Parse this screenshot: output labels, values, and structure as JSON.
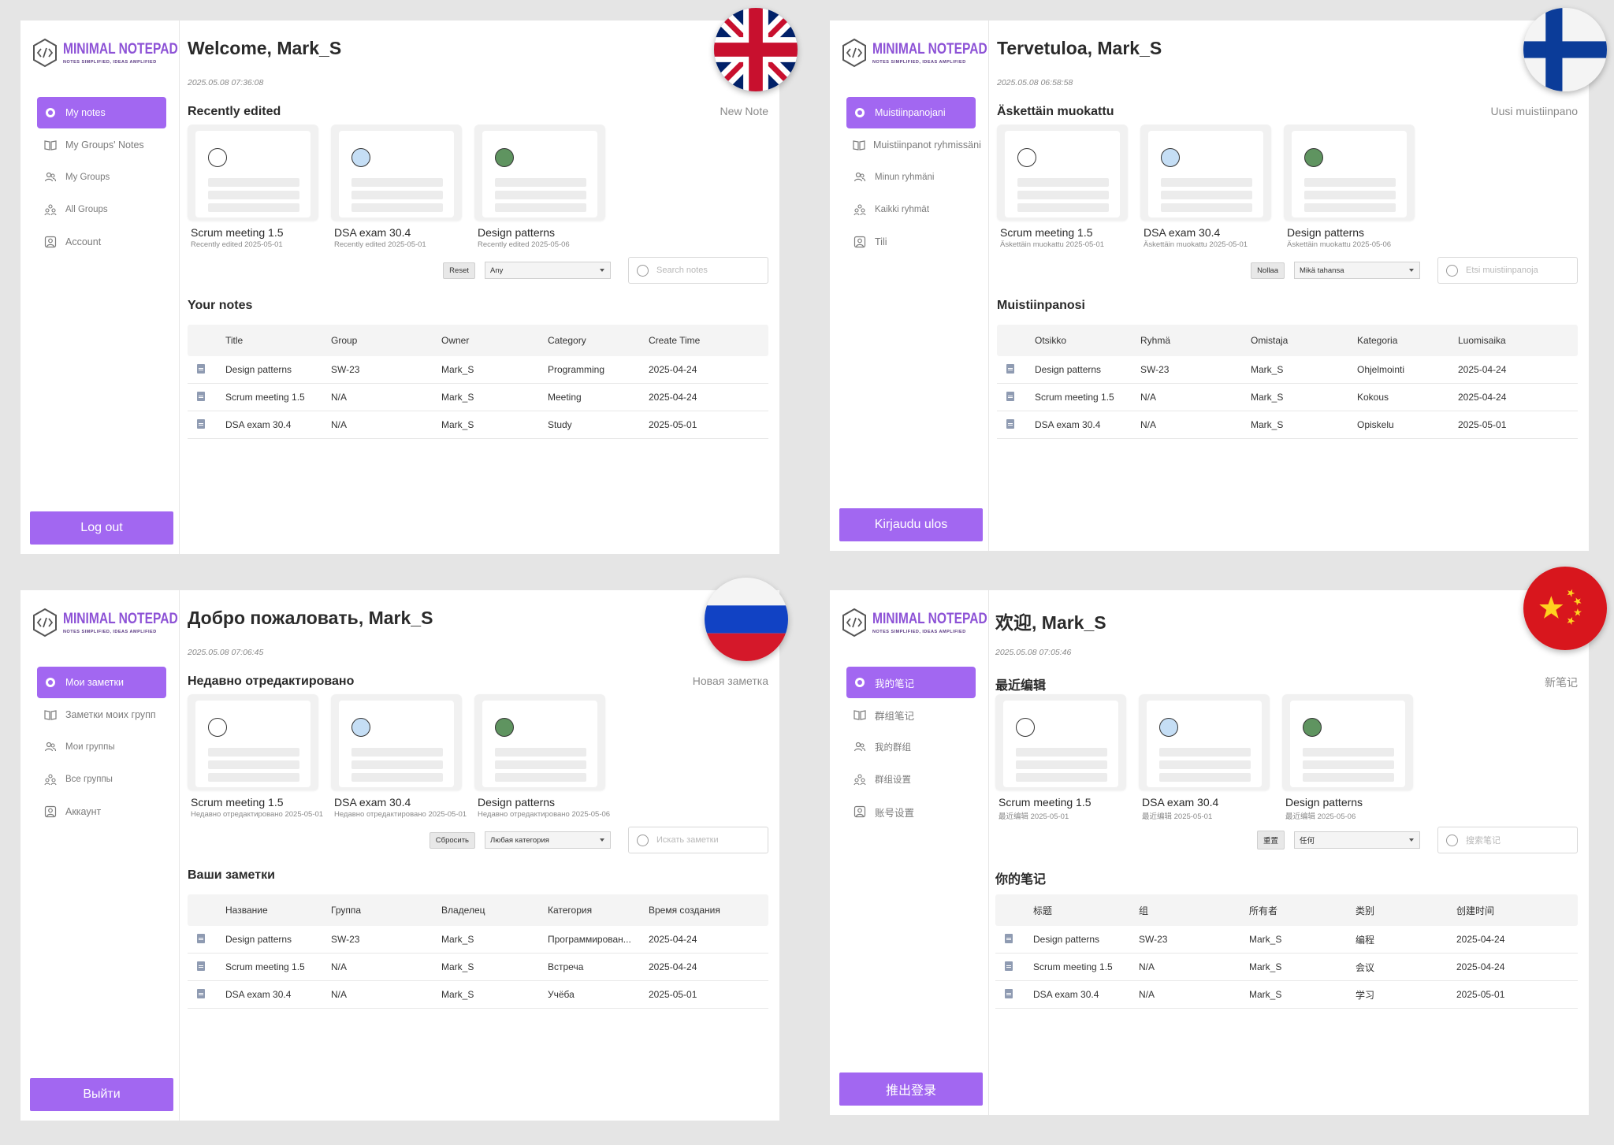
{
  "brand": {
    "title": "MINIMAL NOTEPAD",
    "subtitle": "NOTES SIMPLIFIED, IDEAS AMPLIFIED",
    "accent": "#a267f1",
    "logo_color": "#8d52d6"
  },
  "panels": [
    {
      "language": "English",
      "flag": "uk-flag",
      "welcome": "Welcome, Mark_S",
      "timestamp": "2025.05.08 07:36:08",
      "nav": [
        "My notes",
        "My Groups' Notes",
        "My Groups",
        "All Groups",
        "Account"
      ],
      "logout": "Log out",
      "recent_title": "Recently edited",
      "new_note": "New Note",
      "cards": [
        {
          "title": "Scrum meeting 1.5",
          "sub": "Recently edited 2025-05-01",
          "dot": "#ffffff"
        },
        {
          "title": "DSA exam 30.4",
          "sub": "Recently edited 2025-05-01",
          "dot": "#c5def5"
        },
        {
          "title": "Design patterns",
          "sub": "Recently edited 2025-05-06",
          "dot": "#5f9460"
        }
      ],
      "reset": "Reset",
      "category_select": "Any",
      "search_placeholder": "Search notes",
      "your_notes": "Your notes",
      "headers": [
        "Title",
        "Group",
        "Owner",
        "Category",
        "Create Time"
      ],
      "rows": [
        [
          "Design patterns",
          "SW-23",
          "Mark_S",
          "Programming",
          "2025-04-24"
        ],
        [
          "Scrum meeting 1.5",
          "N/A",
          "Mark_S",
          "Meeting",
          "2025-04-24"
        ],
        [
          "DSA exam 30.4",
          "N/A",
          "Mark_S",
          "Study",
          "2025-05-01"
        ]
      ]
    },
    {
      "language": "Finnish",
      "flag": "finland-flag",
      "welcome": "Tervetuloa, Mark_S",
      "timestamp": "2025.05.08 06:58:58",
      "nav": [
        "Muistiinpanojani",
        "Muistiinpanot ryhmissäni",
        "Minun ryhmäni",
        "Kaikki ryhmät",
        "Tili"
      ],
      "logout": "Kirjaudu ulos",
      "recent_title": "Äskettäin muokattu",
      "new_note": "Uusi muistiinpano",
      "cards": [
        {
          "title": "Scrum meeting 1.5",
          "sub": "Äskettäin muokattu 2025-05-01",
          "dot": "#ffffff"
        },
        {
          "title": "DSA exam 30.4",
          "sub": "Äskettäin muokattu 2025-05-01",
          "dot": "#c5def5"
        },
        {
          "title": "Design patterns",
          "sub": "Äskettäin muokattu 2025-05-06",
          "dot": "#5f9460"
        }
      ],
      "reset": "Nollaa",
      "category_select": "Mikä tahansa",
      "search_placeholder": "Etsi muistiinpanoja",
      "your_notes": "Muistiinpanosi",
      "headers": [
        "Otsikko",
        "Ryhmä",
        "Omistaja",
        "Kategoria",
        "Luomisaika"
      ],
      "rows": [
        [
          "Design patterns",
          "SW-23",
          "Mark_S",
          "Ohjelmointi",
          "2025-04-24"
        ],
        [
          "Scrum meeting 1.5",
          "N/A",
          "Mark_S",
          "Kokous",
          "2025-04-24"
        ],
        [
          "DSA exam 30.4",
          "N/A",
          "Mark_S",
          "Opiskelu",
          "2025-05-01"
        ]
      ]
    },
    {
      "language": "Russian",
      "flag": "russia-flag",
      "welcome": "Добро пожаловать, Mark_S",
      "timestamp": "2025.05.08 07:06:45",
      "nav": [
        "Мои заметки",
        "Заметки моих групп",
        "Мои группы",
        "Все группы",
        "Аккаунт"
      ],
      "logout": "Выйти",
      "recent_title": "Недавно отредактировано",
      "new_note": "Новая заметка",
      "cards": [
        {
          "title": "Scrum meeting 1.5",
          "sub": "Недавно отредактировано 2025-05-01",
          "dot": "#ffffff"
        },
        {
          "title": "DSA exam 30.4",
          "sub": "Недавно отредактировано 2025-05-01",
          "dot": "#c5def5"
        },
        {
          "title": "Design patterns",
          "sub": "Недавно отредактировано 2025-05-06",
          "dot": "#5f9460"
        }
      ],
      "reset": "Сбросить",
      "category_select": "Любая категория",
      "search_placeholder": "Искать заметки",
      "your_notes": "Ваши заметки",
      "headers": [
        "Название",
        "Группа",
        "Владелец",
        "Категория",
        "Время создания"
      ],
      "rows": [
        [
          "Design patterns",
          "SW-23",
          "Mark_S",
          "Программирован...",
          "2025-04-24"
        ],
        [
          "Scrum meeting 1.5",
          "N/A",
          "Mark_S",
          "Встреча",
          "2025-04-24"
        ],
        [
          "DSA exam 30.4",
          "N/A",
          "Mark_S",
          "Учёба",
          "2025-05-01"
        ]
      ]
    },
    {
      "language": "Chinese",
      "flag": "china-flag",
      "welcome": "欢迎, Mark_S",
      "timestamp": "2025.05.08 07:05:46",
      "nav": [
        "我的笔记",
        "群组笔记",
        "我的群组",
        "群组设置",
        "账号设置"
      ],
      "logout": "推出登录",
      "recent_title": "最近编辑",
      "new_note": "新笔记",
      "cards": [
        {
          "title": "Scrum meeting 1.5",
          "sub": "最近编辑 2025-05-01",
          "dot": "#ffffff"
        },
        {
          "title": "DSA exam 30.4",
          "sub": "最近编辑 2025-05-01",
          "dot": "#c5def5"
        },
        {
          "title": "Design patterns",
          "sub": "最近编辑 2025-05-06",
          "dot": "#5f9460"
        }
      ],
      "reset": "重置",
      "category_select": "任何",
      "search_placeholder": "搜索笔记",
      "your_notes": "你的笔记",
      "headers": [
        "标题",
        "组",
        "所有者",
        "类别",
        "创建时间"
      ],
      "rows": [
        [
          "Design patterns",
          "SW-23",
          "Mark_S",
          "编程",
          "2025-04-24"
        ],
        [
          "Scrum meeting 1.5",
          "N/A",
          "Mark_S",
          "会议",
          "2025-04-24"
        ],
        [
          "DSA exam 30.4",
          "N/A",
          "Mark_S",
          "学习",
          "2025-05-01"
        ]
      ]
    }
  ]
}
